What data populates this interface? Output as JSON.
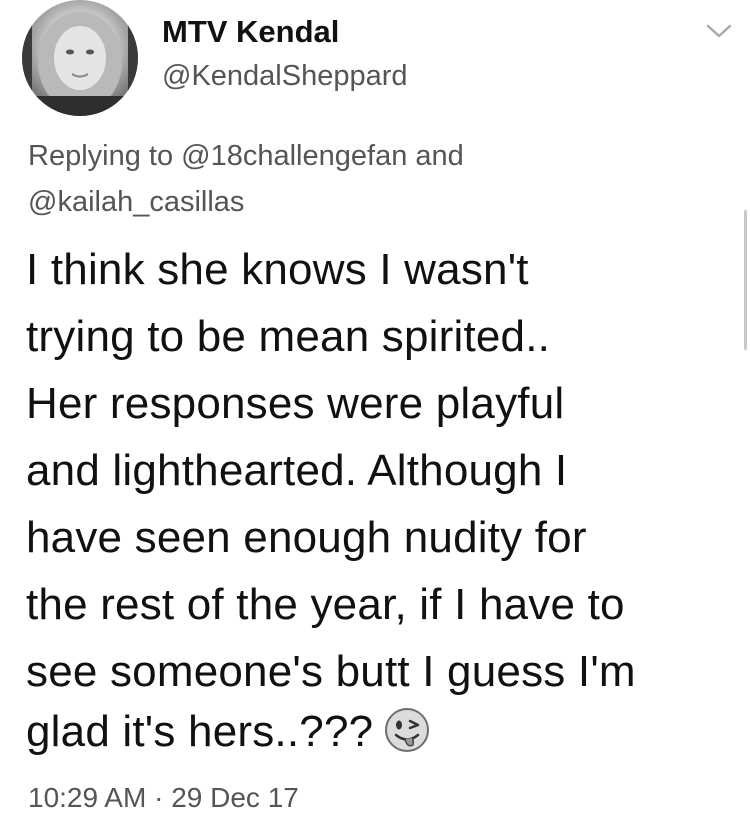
{
  "author": {
    "display_name": "MTV Kendal",
    "handle": "@KendalSheppard"
  },
  "reply_context": {
    "prefix": "Replying to",
    "mention_1": "@18challengefan",
    "joiner": "and",
    "mention_2": "@kailah_casillas"
  },
  "tweet": {
    "lines": [
      "I think she knows I wasn't",
      "trying to be mean spirited..",
      "Her responses were playful",
      "and lighthearted. Although I",
      "have seen enough nudity for",
      "the rest of the year, if I have to",
      "see someone's butt I guess I'm",
      "glad it's hers..???"
    ],
    "emoji": "winking-face-with-tongue"
  },
  "timestamp": {
    "time": "10:29 AM",
    "separator": "·",
    "date": "29 Dec 17"
  },
  "icons": {
    "menu": "chevron-down-icon",
    "avatar": "profile-avatar"
  }
}
